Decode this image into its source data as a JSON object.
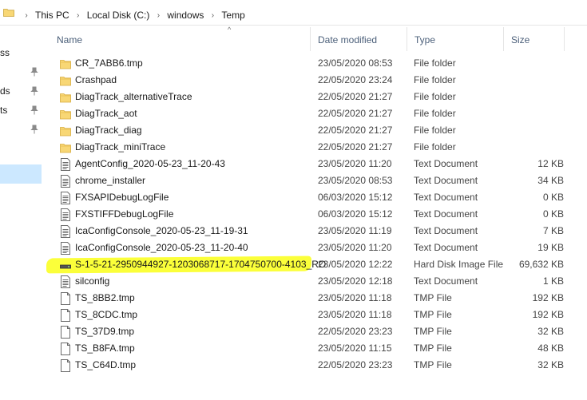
{
  "address_bar": {
    "crumbs": [
      "This PC",
      "Local Disk (C:)",
      "windows",
      "Temp"
    ]
  },
  "nav_pane": {
    "items": [
      {
        "label": "ss",
        "pinned": false
      },
      {
        "label": "ds",
        "pinned": true
      },
      {
        "label": "ts",
        "pinned": true
      }
    ]
  },
  "columns": {
    "name": "Name",
    "date_modified": "Date modified",
    "type": "Type",
    "size": "Size"
  },
  "files": [
    {
      "name": "CR_7ABB6.tmp",
      "date": "23/05/2020 08:53",
      "type": "File folder",
      "size": "",
      "icon": "folder-icon"
    },
    {
      "name": "Crashpad",
      "date": "22/05/2020 23:24",
      "type": "File folder",
      "size": "",
      "icon": "folder-icon"
    },
    {
      "name": "DiagTrack_alternativeTrace",
      "date": "22/05/2020 21:27",
      "type": "File folder",
      "size": "",
      "icon": "folder-icon"
    },
    {
      "name": "DiagTrack_aot",
      "date": "22/05/2020 21:27",
      "type": "File folder",
      "size": "",
      "icon": "folder-icon"
    },
    {
      "name": "DiagTrack_diag",
      "date": "22/05/2020 21:27",
      "type": "File folder",
      "size": "",
      "icon": "folder-icon"
    },
    {
      "name": "DiagTrack_miniTrace",
      "date": "22/05/2020 21:27",
      "type": "File folder",
      "size": "",
      "icon": "folder-icon"
    },
    {
      "name": "AgentConfig_2020-05-23_11-20-43",
      "date": "23/05/2020 11:20",
      "type": "Text Document",
      "size": "12 KB",
      "icon": "text-document-icon"
    },
    {
      "name": "chrome_installer",
      "date": "23/05/2020 08:53",
      "type": "Text Document",
      "size": "34 KB",
      "icon": "text-document-icon"
    },
    {
      "name": "FXSAPIDebugLogFile",
      "date": "06/03/2020 15:12",
      "type": "Text Document",
      "size": "0 KB",
      "icon": "text-document-icon"
    },
    {
      "name": "FXSTIFFDebugLogFile",
      "date": "06/03/2020 15:12",
      "type": "Text Document",
      "size": "0 KB",
      "icon": "text-document-icon"
    },
    {
      "name": "IcaConfigConsole_2020-05-23_11-19-31",
      "date": "23/05/2020 11:19",
      "type": "Text Document",
      "size": "7 KB",
      "icon": "text-document-icon"
    },
    {
      "name": "IcaConfigConsole_2020-05-23_11-20-40",
      "date": "23/05/2020 11:20",
      "type": "Text Document",
      "size": "19 KB",
      "icon": "text-document-icon"
    },
    {
      "name": "S-1-5-21-2950944927-1203068717-1704750700-4103_RO",
      "date": "23/05/2020 12:22",
      "type": "Hard Disk Image File",
      "size": "69,632 KB",
      "icon": "disk-image-icon",
      "highlighted": true
    },
    {
      "name": "silconfig",
      "date": "23/05/2020 12:18",
      "type": "Text Document",
      "size": "1 KB",
      "icon": "text-document-icon"
    },
    {
      "name": "TS_8BB2.tmp",
      "date": "23/05/2020 11:18",
      "type": "TMP File",
      "size": "192 KB",
      "icon": "blank-file-icon"
    },
    {
      "name": "TS_8CDC.tmp",
      "date": "23/05/2020 11:18",
      "type": "TMP File",
      "size": "192 KB",
      "icon": "blank-file-icon"
    },
    {
      "name": "TS_37D9.tmp",
      "date": "22/05/2020 23:23",
      "type": "TMP File",
      "size": "32 KB",
      "icon": "blank-file-icon"
    },
    {
      "name": "TS_B8FA.tmp",
      "date": "23/05/2020 11:15",
      "type": "TMP File",
      "size": "48 KB",
      "icon": "blank-file-icon"
    },
    {
      "name": "TS_C64D.tmp",
      "date": "22/05/2020 23:23",
      "type": "TMP File",
      "size": "32 KB",
      "icon": "blank-file-icon"
    }
  ],
  "colors": {
    "folder": "#f8d775",
    "highlight": "#fbff3a",
    "header_text": "#4c607a",
    "nav_selected": "#cce8ff"
  }
}
